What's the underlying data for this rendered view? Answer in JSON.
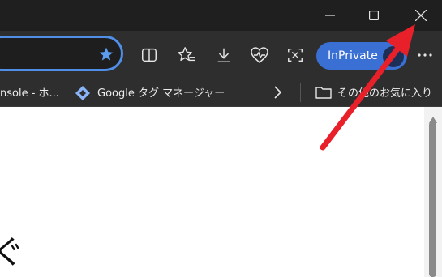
{
  "window_controls": {
    "minimize_icon": "minimize-icon",
    "maximize_icon": "maximize-icon",
    "close_icon": "close-icon"
  },
  "toolbar": {
    "favorite_star_icon": "star-filled-icon",
    "split_screen_icon": "split-screen-icon",
    "favorites_icon": "favorites-icon",
    "downloads_icon": "download-icon",
    "health_icon": "browser-essentials-icon",
    "screenshot_icon": "screenshot-icon",
    "inprivate_label": "InPrivate",
    "more_icon": "more-icon"
  },
  "favorites_bar": {
    "item1_label": "nsole - ホ...",
    "item2_label": "Google タグ マネージャー",
    "other_favorites_label": "その他のお気に入り"
  },
  "content": {
    "partial_text": "ぐ"
  },
  "colors": {
    "accent": "#4f8fe8",
    "inprivate": "#3a6fd3",
    "annotation_arrow": "#e8202a"
  }
}
